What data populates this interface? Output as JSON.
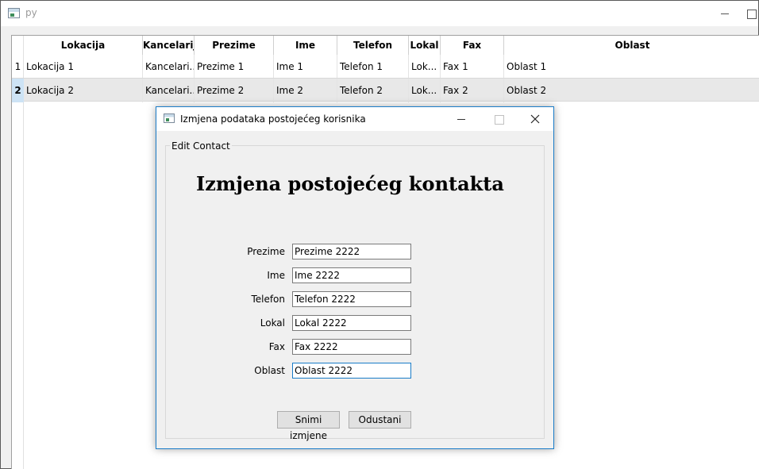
{
  "main_window": {
    "title": "py"
  },
  "table": {
    "columns": [
      "Lokacija",
      "Kancelarija",
      "Prezime",
      "Ime",
      "Telefon",
      "Lokal",
      "Fax",
      "Oblast"
    ],
    "rows": [
      {
        "num": "1",
        "cells": [
          "Lokacija 1",
          "Kancelari...",
          "Prezime 1",
          "Ime 1",
          "Telefon 1",
          "Lok...",
          "Fax 1",
          "Oblast 1"
        ]
      },
      {
        "num": "2",
        "cells": [
          "Lokacija 2",
          "Kancelari...",
          "Prezime 2",
          "Ime 2",
          "Telefon 2",
          "Lok...",
          "Fax 2",
          "Oblast 2"
        ]
      }
    ],
    "selected_row": "2"
  },
  "dialog": {
    "title": "Izmjena podataka postojećeg korisnika",
    "group_title": "Edit Contact",
    "heading": "Izmjena postojećeg kontakta",
    "fields": [
      {
        "label": "Prezime",
        "value": "Prezime 2222"
      },
      {
        "label": "Ime",
        "value": "Ime 2222"
      },
      {
        "label": "Telefon",
        "value": "Telefon 2222"
      },
      {
        "label": "Lokal",
        "value": "Lokal 2222"
      },
      {
        "label": "Fax",
        "value": "Fax 2222"
      },
      {
        "label": "Oblast",
        "value": "Oblast 2222"
      }
    ],
    "save_label": "Snimi izmjene",
    "cancel_label": "Odustani"
  },
  "colors": {
    "accent": "#1a7cc8",
    "selected_row_header": "#cde3f5"
  },
  "icons": [
    "app-icon",
    "minimize-icon",
    "maximize-icon",
    "close-icon"
  ]
}
